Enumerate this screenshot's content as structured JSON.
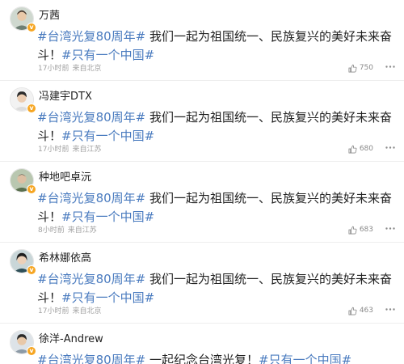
{
  "colors": {
    "link": "#4a7bbf",
    "text": "#222222",
    "meta": "#a0a0a0",
    "verified_badge": "#f6a623"
  },
  "icons": {
    "like": "thumbs-up-icon",
    "more": "more-dots-icon",
    "verified": "verified-badge-icon"
  },
  "comments": [
    {
      "username": "万茜",
      "tag1": "#台湾光复80周年#",
      "body": " 我们一起为祖国统一、民族复兴的美好未来奋斗！",
      "tag2": "#只有一个中国#",
      "time": "17小时前",
      "location": "来自北京",
      "likes": "750"
    },
    {
      "username": "冯建宇DTX",
      "tag1": "#台湾光复80周年#",
      "body": " 我们一起为祖国统一、民族复兴的美好未来奋斗！",
      "tag2": "#只有一个中国#",
      "time": "17小时前",
      "location": "来自江苏",
      "likes": "680"
    },
    {
      "username": "种地吧卓沅",
      "tag1": "#台湾光复80周年#",
      "body": " 我们一起为祖国统一、民族复兴的美好未来奋斗！",
      "tag2": "#只有一个中国#",
      "time": "8小时前",
      "location": "来自江苏",
      "likes": "683"
    },
    {
      "username": "希林娜依高",
      "tag1": "#台湾光复80周年#",
      "body": " 我们一起为祖国统一、民族复兴的美好未来奋斗！",
      "tag2": "#只有一个中国#",
      "time": "17小时前",
      "location": "来自北京",
      "likes": "463"
    },
    {
      "username": "徐洋-Andrew",
      "tag1": "#台湾光复80周年#",
      "body": " 一起纪念台湾光复！",
      "tag2": "#只有一个中国#",
      "time": "",
      "location": "",
      "likes": ""
    }
  ]
}
